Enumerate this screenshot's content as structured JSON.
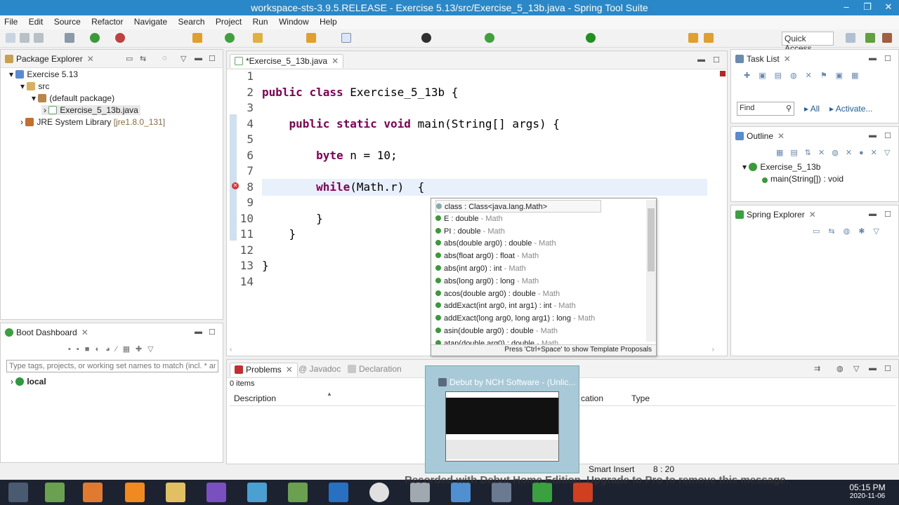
{
  "window": {
    "title": "workspace-sts-3.9.5.RELEASE - Exercise 5.13/src/Exercise_5_13b.java - Spring Tool Suite",
    "minimize": "‒",
    "restore": "❐",
    "close": "✕"
  },
  "menu": [
    "File",
    "Edit",
    "Source",
    "Refactor",
    "Navigate",
    "Search",
    "Project",
    "Run",
    "Window",
    "Help"
  ],
  "toolbar": {
    "quick_access": "Quick Access"
  },
  "package_explorer": {
    "tab_label": "Package Explorer",
    "items": [
      {
        "label": "Exercise 5.13",
        "icon": "project-icon"
      },
      {
        "label": "src",
        "icon": "src-folder-icon"
      },
      {
        "label": "(default package)",
        "icon": "package-icon"
      },
      {
        "label": "Exercise_5_13b.java",
        "icon": "java-file-icon"
      },
      {
        "label": "JRE System Library",
        "suffix": "[jre1.8.0_131]",
        "icon": "library-icon"
      }
    ]
  },
  "boot_dashboard": {
    "tab_label": "Boot Dashboard",
    "filter_placeholder": "Type tags, projects, or working set names to match (incl. * an",
    "items": [
      {
        "label": "local"
      }
    ]
  },
  "editor": {
    "tab_label": "*Exercise_5_13b.java",
    "line_numbers": [
      "1",
      "2",
      "3",
      "4",
      "5",
      "6",
      "7",
      "8",
      "9",
      "10",
      "11",
      "12",
      "13",
      "14"
    ],
    "lines": [
      "",
      "public class Exercise_5_13b {",
      "",
      "    public static void main(String[] args) {",
      "",
      "        byte n = 10;",
      "",
      "        while(Math.r)  {",
      "",
      "        }",
      "    }",
      "",
      "}",
      ""
    ]
  },
  "completion": {
    "items": [
      {
        "name": "class : Class<java.lang.Math>",
        "owner": ""
      },
      {
        "name": "E : double",
        "owner": "Math"
      },
      {
        "name": "PI : double",
        "owner": "Math"
      },
      {
        "name": "abs(double arg0) : double",
        "owner": "Math"
      },
      {
        "name": "abs(float arg0) : float",
        "owner": "Math"
      },
      {
        "name": "abs(int arg0) : int",
        "owner": "Math"
      },
      {
        "name": "abs(long arg0) : long",
        "owner": "Math"
      },
      {
        "name": "acos(double arg0) : double",
        "owner": "Math"
      },
      {
        "name": "addExact(int arg0, int arg1) : int",
        "owner": "Math"
      },
      {
        "name": "addExact(long arg0, long arg1) : long",
        "owner": "Math"
      },
      {
        "name": "asin(double arg0) : double",
        "owner": "Math"
      },
      {
        "name": "atan(double arg0) : double",
        "owner": "Math"
      }
    ],
    "footer": "Press 'Ctrl+Space' to show Template Proposals"
  },
  "task_list": {
    "tab_label": "Task List",
    "find_placeholder": "Find",
    "all_label": "All",
    "activate_label": "Activate..."
  },
  "outline": {
    "tab_label": "Outline",
    "items": [
      {
        "label": "Exercise_5_13b"
      },
      {
        "label": "main(String[]) : void"
      }
    ]
  },
  "spring_explorer": {
    "tab_label": "Spring Explorer"
  },
  "problems": {
    "tab_label": "Problems",
    "tab_javadoc": "Javadoc",
    "tab_declaration": "Declaration",
    "count": "0 items",
    "columns": [
      "Description",
      "cation",
      "Type"
    ]
  },
  "debut_popup": {
    "title": "Debut by NCH Software - (Unlic..."
  },
  "status": {
    "mode": "Smart Insert",
    "position": "8 : 20"
  },
  "watermark": "Recorded with Debut Home Edition. Upgrade to Pro to remove this message.",
  "taskbar": {
    "time": "05:15 PM",
    "date": "2020-11-06"
  },
  "colors": {
    "titlebar": "#2b88c8",
    "keyword": "#7f0055",
    "taskbar": "#1c2230"
  }
}
